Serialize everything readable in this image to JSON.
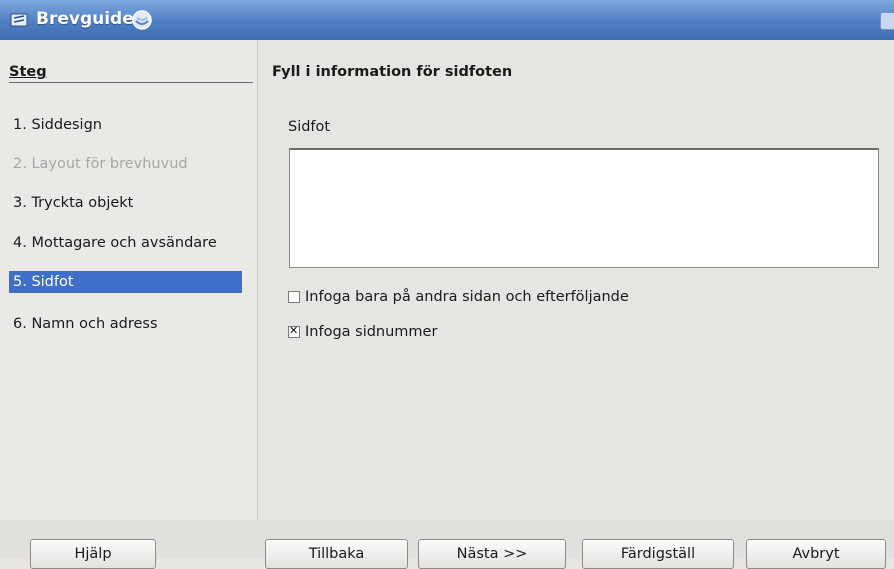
{
  "window": {
    "title": "Brevguiden"
  },
  "sidebar": {
    "heading": "Steg",
    "steps": [
      {
        "label": "1. Siddesign",
        "state": "normal"
      },
      {
        "label": "2. Layout för brevhuvud",
        "state": "disabled"
      },
      {
        "label": "3. Tryckta objekt",
        "state": "normal"
      },
      {
        "label": "4. Mottagare och avsändare",
        "state": "normal"
      },
      {
        "label": "5. Sidfot",
        "state": "active"
      },
      {
        "label": "6. Namn och adress",
        "state": "normal"
      }
    ]
  },
  "main": {
    "title": "Fyll i information för sidfoten",
    "footer_label": "Sidfot",
    "footer_value": "",
    "only_second_page_label": "Infoga bara på andra sidan och efterföljande",
    "only_second_page_checked": false,
    "page_number_label": "Infoga sidnummer",
    "page_number_checked": true
  },
  "buttons": {
    "help": "Hjälp",
    "back": "Tillbaka",
    "next": "Nästa >>",
    "finish": "Färdigställ",
    "cancel": "Avbryt"
  },
  "colors": {
    "title_bar": "#4f7fc4",
    "selection": "#3f6fc8"
  }
}
